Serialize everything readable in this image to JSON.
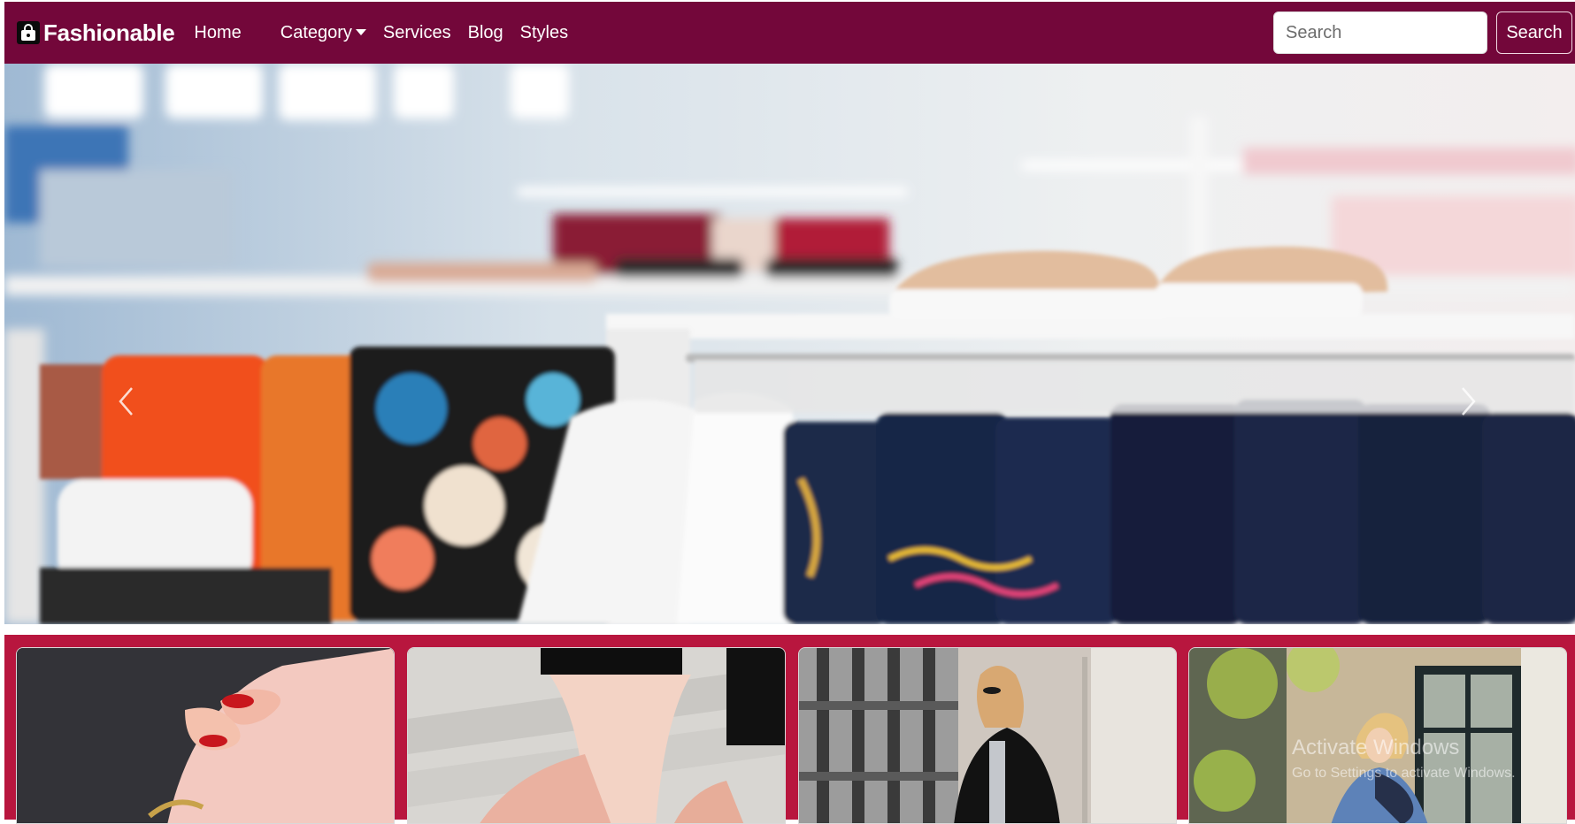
{
  "navbar": {
    "brand": "Fashionable",
    "brand_icon": "shopping-bag-icon",
    "links": [
      "Home",
      "Category",
      "Services",
      "Blog",
      "Styles"
    ],
    "search_placeholder": "Search",
    "search_button": "Search",
    "background": "#73073a"
  },
  "hero": {
    "prev_icon": "chevron-left-icon",
    "next_icon": "chevron-right-icon"
  },
  "cards": {
    "background": "#b8163e"
  },
  "watermark": {
    "title": "Activate Windows",
    "subtitle": "Go to Settings to activate Windows."
  }
}
